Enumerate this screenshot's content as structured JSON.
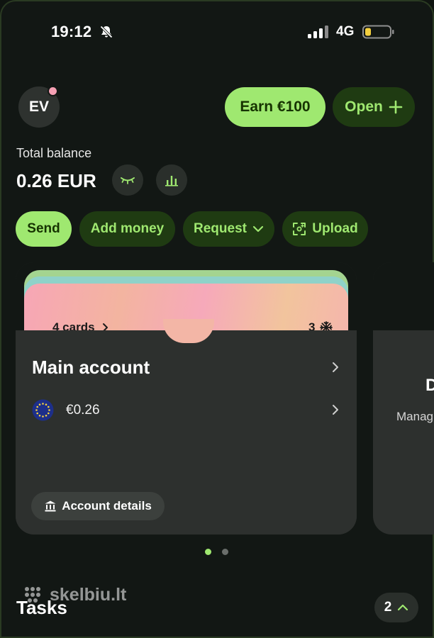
{
  "status_bar": {
    "time": "19:12",
    "network": "4G",
    "icons": [
      "bell-muted-icon",
      "signal-icon",
      "battery-low-icon"
    ]
  },
  "header": {
    "avatar_initials": "EV",
    "earn_button": "Earn €100",
    "open_button": "Open"
  },
  "balance": {
    "label": "Total balance",
    "amount": "0.26 EUR"
  },
  "actions": {
    "send": "Send",
    "add_money": "Add money",
    "request": "Request",
    "upload": "Upload"
  },
  "account_card": {
    "cards_count": "4 cards",
    "frozen_count": "3",
    "title": "Main account",
    "currency_amount": "€0.26",
    "details_button": "Account details"
  },
  "next_card": {
    "title": "D",
    "subtitle": "Manag"
  },
  "pager": {
    "total": 2,
    "active": 1
  },
  "watermark": "skelbiu.lt",
  "tasks": {
    "title": "Tasks",
    "count": "2"
  },
  "colors": {
    "accent": "#9fe870",
    "accent_dark": "#163300",
    "secondary_bg": "#1f3b12",
    "background": "#121714",
    "card_bg": "#2d302e"
  }
}
